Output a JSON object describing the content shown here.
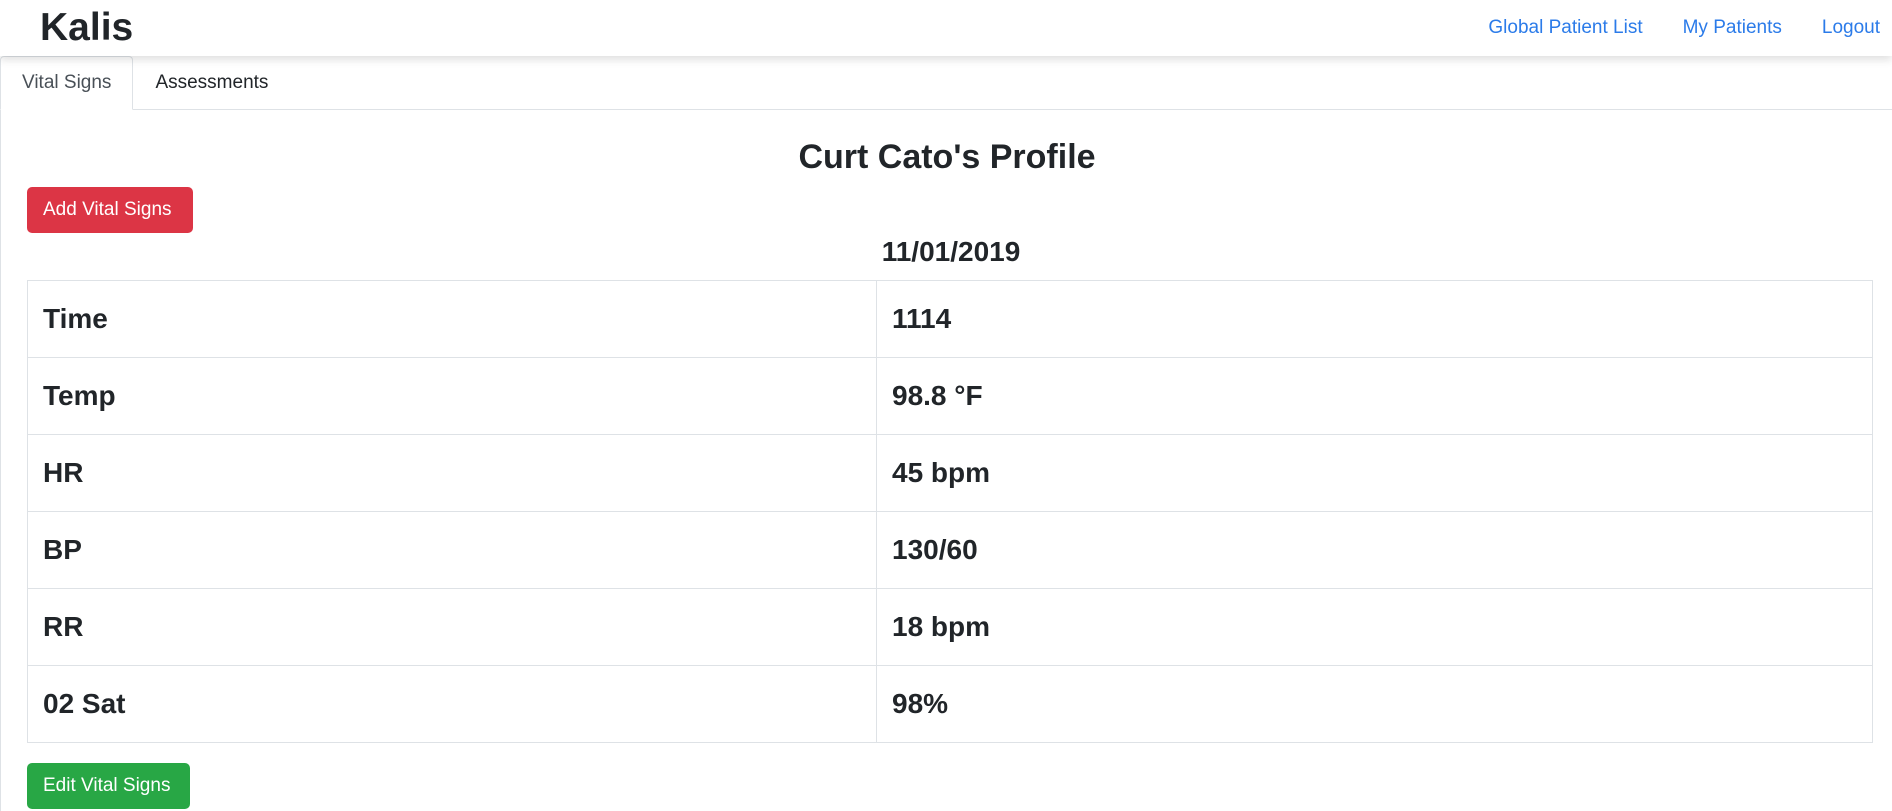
{
  "navbar": {
    "brand": "Kalis",
    "links": [
      {
        "label": "Global Patient List"
      },
      {
        "label": "My Patients"
      },
      {
        "label": "Logout"
      }
    ],
    "link_color": "#2b7be9"
  },
  "tabs": [
    {
      "label": "Vital Signs",
      "active": true
    },
    {
      "label": "Assessments",
      "active": false
    }
  ],
  "profile": {
    "title": "Curt Cato's Profile",
    "add_button_label": "Add Vital Signs",
    "edit_button_label": "Edit Vital Signs",
    "date": "11/01/2019",
    "vitals": [
      {
        "label": "Time",
        "value": "1114"
      },
      {
        "label": "Temp",
        "value": "98.8 °F"
      },
      {
        "label": "HR",
        "value": "45 bpm"
      },
      {
        "label": "BP",
        "value": "130/60"
      },
      {
        "label": "RR",
        "value": "18 bpm"
      },
      {
        "label": "02 Sat",
        "value": "98%"
      }
    ]
  },
  "colors": {
    "add_button": "#dc3545",
    "edit_button": "#28a745"
  }
}
